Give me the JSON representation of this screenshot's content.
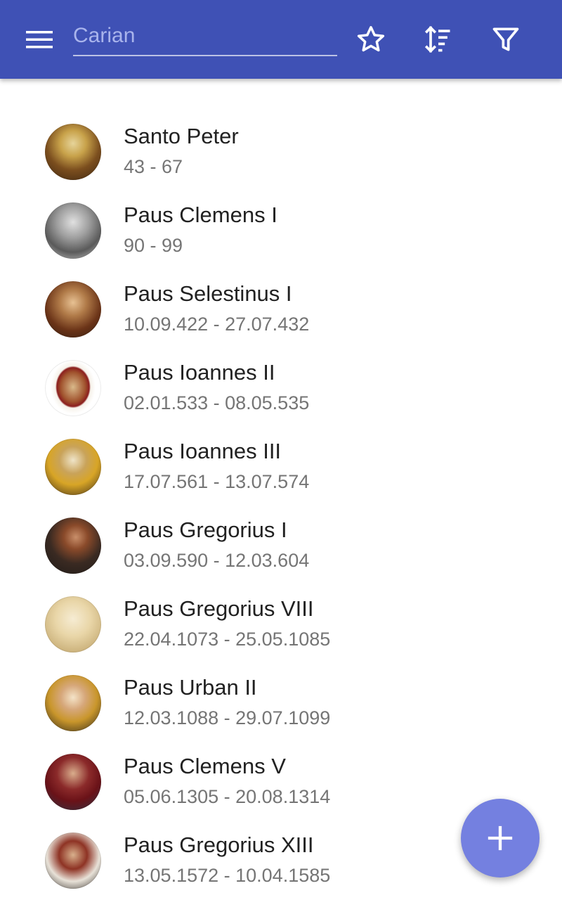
{
  "header": {
    "search_placeholder": "Carian",
    "search_value": "",
    "icons": [
      "menu-icon",
      "star-outline-icon",
      "sort-icon",
      "filter-icon"
    ]
  },
  "colors": {
    "appbar": "#3f51b5",
    "fab": "#7480e0",
    "primary_text": "#212121",
    "secondary_text": "#757575"
  },
  "popes": [
    {
      "name": "Santo Peter",
      "dates": "43 - 67"
    },
    {
      "name": "Paus Clemens I",
      "dates": "90 - 99"
    },
    {
      "name": "Paus Selestinus I",
      "dates": "10.09.422 - 27.07.432"
    },
    {
      "name": "Paus Ioannes II",
      "dates": "02.01.533 - 08.05.535"
    },
    {
      "name": "Paus Ioannes III",
      "dates": "17.07.561 - 13.07.574"
    },
    {
      "name": "Paus Gregorius I",
      "dates": "03.09.590 - 12.03.604"
    },
    {
      "name": "Paus Gregorius VIII",
      "dates": "22.04.1073 - 25.05.1085"
    },
    {
      "name": "Paus Urban II",
      "dates": "12.03.1088 - 29.07.1099"
    },
    {
      "name": "Paus Clemens V",
      "dates": "05.06.1305 - 20.08.1314"
    },
    {
      "name": "Paus Gregorius XIII",
      "dates": "13.05.1572 - 10.04.1585"
    }
  ],
  "fab": {
    "icon": "plus-icon"
  }
}
